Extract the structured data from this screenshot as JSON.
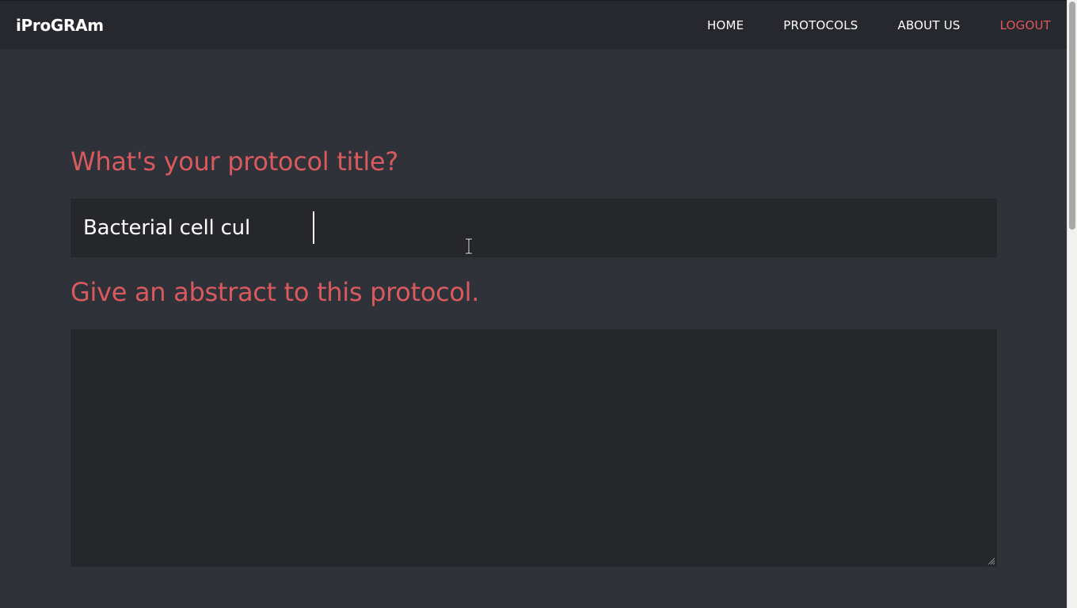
{
  "navbar": {
    "brand": "iProGRAm",
    "links": [
      {
        "label": "HOME"
      },
      {
        "label": "PROTOCOLS"
      },
      {
        "label": "ABOUT US"
      },
      {
        "label": "LOGOUT"
      }
    ]
  },
  "form": {
    "title_question": "What's your protocol title?",
    "title_value": "Bacterial cell cul",
    "abstract_question": "Give an abstract to this protocol.",
    "abstract_value": ""
  },
  "colors": {
    "background": "#30323a",
    "navbar_bg": "#26282d",
    "input_bg": "#25272b",
    "accent": "#d85a5e",
    "logout": "#e0585c",
    "text": "#ffffff"
  },
  "icons": {
    "mouse_cursor": "i-beam-cursor-icon",
    "textarea_resize": "resize-grip-icon"
  }
}
